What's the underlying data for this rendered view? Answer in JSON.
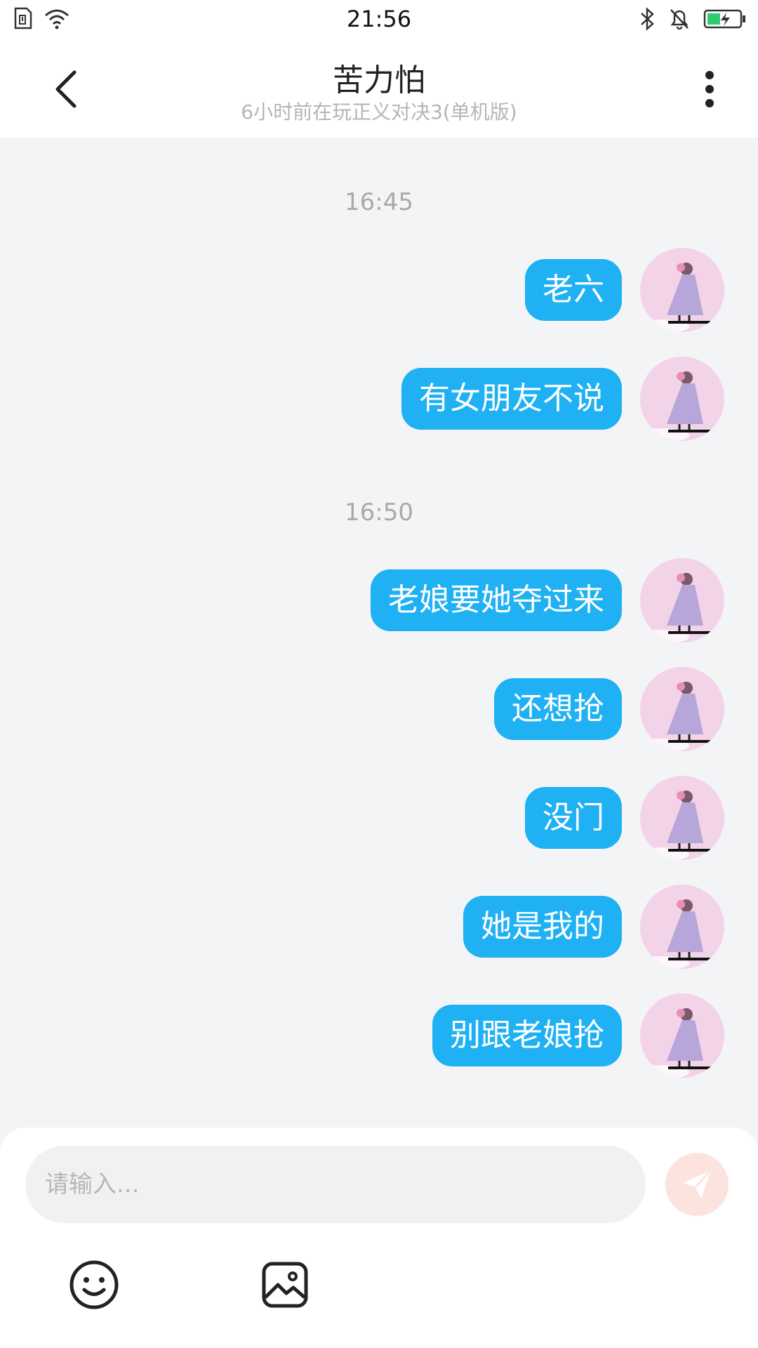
{
  "status_bar": {
    "time": "21:56",
    "icons": [
      "sim-card-icon",
      "wifi-icon",
      "bluetooth-icon",
      "bell-muted-icon",
      "battery-charging-icon"
    ],
    "battery_color": "#2ecc71"
  },
  "header": {
    "title": "苦力怕",
    "subtitle": "6小时前在玩正义对决3(单机版)",
    "back_icon": "chevron-left-icon",
    "more_icon": "more-vertical-icon"
  },
  "chat": {
    "groups": [
      {
        "time": "16:45",
        "messages": [
          "老六",
          "有女朋友不说"
        ]
      },
      {
        "time": "16:50",
        "messages": [
          "老娘要她夺过来",
          "还想抢",
          "没门",
          "她是我的",
          "别跟老娘抢"
        ]
      }
    ],
    "bubble_color": "#1fb1f3",
    "avatar_color": "#f3d3e8"
  },
  "input": {
    "placeholder": "请输入...",
    "send_icon": "paper-plane-icon",
    "send_color": "#fde3dd",
    "toolbar_icons": [
      "smiley-icon",
      "image-icon"
    ]
  }
}
